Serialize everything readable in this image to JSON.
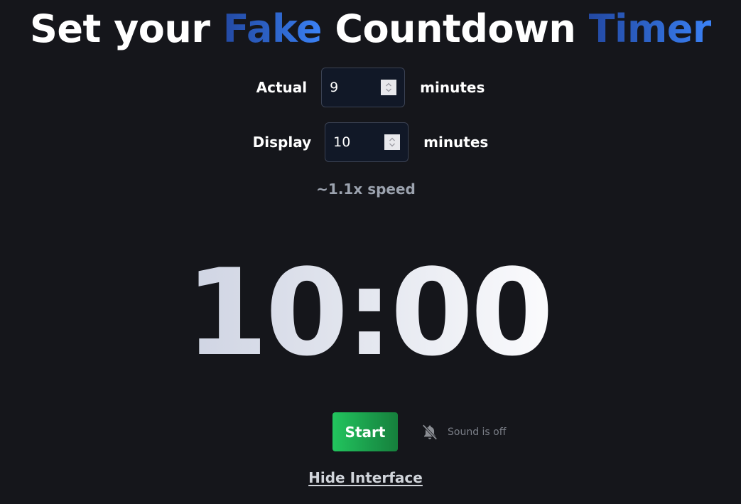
{
  "header": {
    "title_parts": {
      "part1": "Set your ",
      "part2": "Fake",
      "part3": " Countdown ",
      "part4": "Timer"
    },
    "accent_gradient": [
      "#2349a3",
      "#3b82f6"
    ]
  },
  "settings": {
    "actual": {
      "label": "Actual",
      "value": "9",
      "unit": "minutes"
    },
    "display": {
      "label": "Display",
      "value": "10",
      "unit": "minutes"
    },
    "speed_text": "~1.1x speed"
  },
  "timer": {
    "value": "10:00"
  },
  "controls": {
    "start_label": "Start",
    "start_color": "#22c55e",
    "sound_icon": "bell-slash-icon",
    "sound_label": "Sound is off"
  },
  "footer": {
    "hide_label": "Hide Interface"
  },
  "colors": {
    "background": "#15161b",
    "input_background": "#111827",
    "muted_text": "#9ca3af"
  }
}
